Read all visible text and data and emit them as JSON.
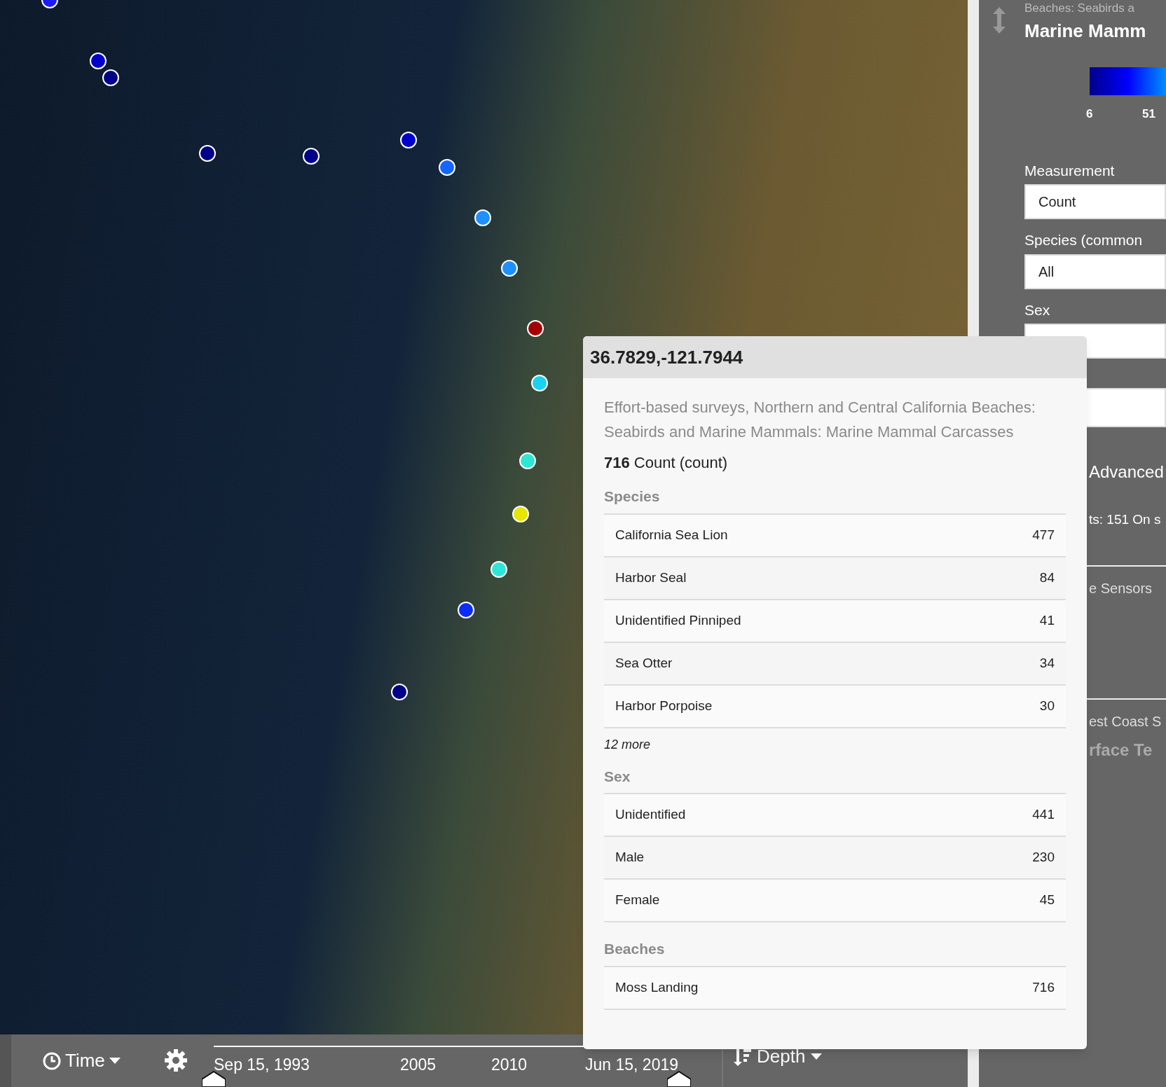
{
  "map": {
    "markers": [
      {
        "color": "#1a1aff"
      },
      {
        "color": "#0000cc"
      },
      {
        "color": "#00008b"
      },
      {
        "color": "#00008b"
      },
      {
        "color": "#00008b"
      },
      {
        "color": "#0000cc"
      },
      {
        "color": "#1565ff"
      },
      {
        "color": "#1e90ff"
      },
      {
        "color": "#1e90ff"
      },
      {
        "color": "#a50000"
      },
      {
        "color": "#1ad1f0"
      },
      {
        "color": "#2ee6d6"
      },
      {
        "color": "#e6e600"
      },
      {
        "color": "#2ee6d6"
      },
      {
        "color": "#0a2cff"
      },
      {
        "color": "#00008b"
      }
    ]
  },
  "popup": {
    "title": "36.7829,-121.7944",
    "description": "Effort-based surveys, Northern and Central California Beaches: Seabirds and Marine Mammals: Marine Mammal Carcasses",
    "value": "**716** Count (count)",
    "sections": [
      {
        "heading": "Species",
        "rows": [
          {
            "label": "California Sea Lion",
            "value": "477"
          },
          {
            "label": "Harbor Seal",
            "value": "84"
          },
          {
            "label": "Unidentified Pinniped",
            "value": "41"
          },
          {
            "label": "Sea Otter",
            "value": "34"
          },
          {
            "label": "Harbor Porpoise",
            "value": "30"
          }
        ],
        "more": "12 more"
      },
      {
        "heading": "Sex",
        "rows": [
          {
            "label": "Unidentified",
            "value": "441"
          },
          {
            "label": "Male",
            "value": "230"
          },
          {
            "label": "Female",
            "value": "45"
          }
        ]
      },
      {
        "heading": "Beaches",
        "rows": [
          {
            "label": "Moss Landing",
            "value": "716"
          }
        ]
      }
    ]
  },
  "panel": {
    "subtitle": "Beaches: Seabirds a",
    "title": "Marine Mamm",
    "legend_ticks": [
      "6",
      "51"
    ],
    "fields": [
      {
        "label": "Measurement",
        "value": "Count"
      },
      {
        "label": "Species (common",
        "value": "All"
      },
      {
        "label": "Sex"
      }
    ],
    "advanced": "Advanced",
    "total": "ts: 151 On s",
    "layers": [
      {
        "subtitle": "e Sensors"
      },
      {
        "subtitle": "est Coast S",
        "title": "rface Te"
      }
    ]
  },
  "timebar": {
    "time_label": "Time",
    "ticks": [
      "Sep 15, 1993",
      "2005",
      "2010",
      "Jun 15, 2019"
    ],
    "depth_label": "Depth"
  }
}
